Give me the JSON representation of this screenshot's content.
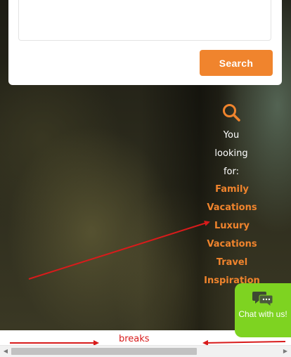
{
  "search": {
    "textarea_value": "",
    "button_label": "Search"
  },
  "looking_for": {
    "icon": "search-icon",
    "lines": [
      "You",
      "looking",
      "for:"
    ],
    "links": [
      "Family",
      "Vacations",
      "Luxury",
      "Vacations",
      "Travel",
      "Inspiration"
    ]
  },
  "chat": {
    "icon": "chat-bubbles-icon",
    "label": "Chat with us!"
  },
  "annotation": {
    "label": "breaks"
  },
  "colors": {
    "accent": "#f0842d",
    "chat": "#7ed321",
    "annotation": "#d81b1b"
  }
}
